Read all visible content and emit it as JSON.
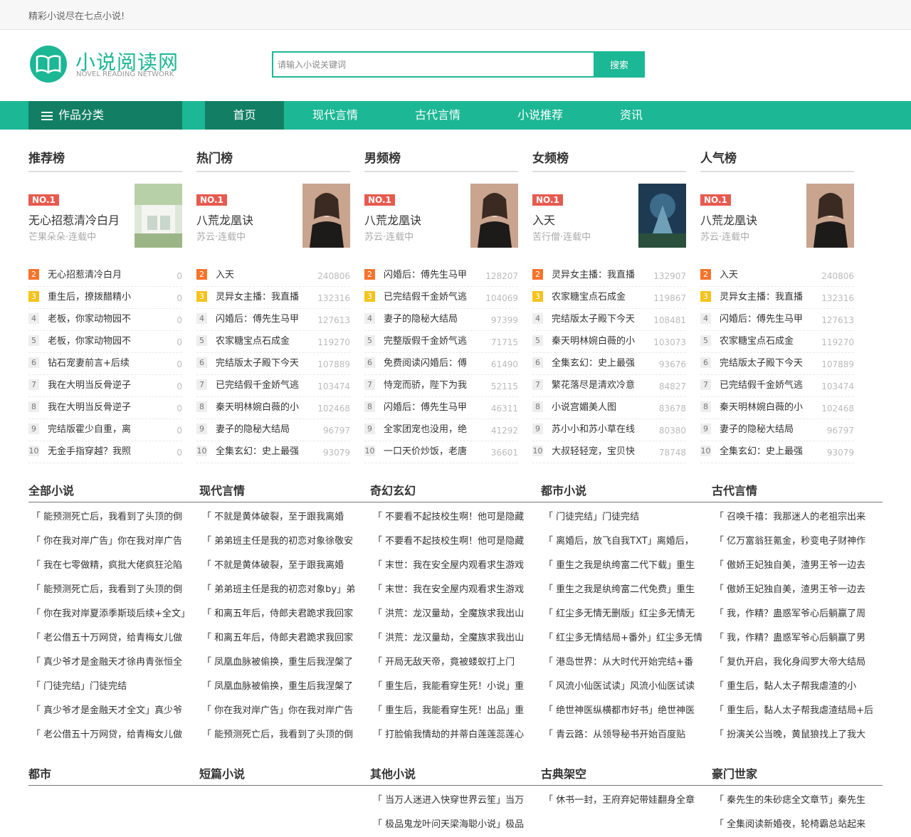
{
  "topbar": {
    "slogan": "精彩小说尽在七点小说!"
  },
  "logo": {
    "title": "小说阅读网",
    "subtitle": "NOVEL READING NETWORK",
    "icon": "open-book-icon"
  },
  "search": {
    "placeholder": "请输入小说关键词",
    "button": "搜索"
  },
  "nav": {
    "category": "作品分类",
    "items": [
      "首页",
      "现代言情",
      "古代言情",
      "小说推荐",
      "资讯"
    ]
  },
  "colors": {
    "accent": "#1cb795",
    "accent_dark": "#127f64",
    "badge": "#e85a4f"
  },
  "rankings": [
    {
      "title": "推荐榜",
      "badge": "NO.1",
      "featured_title": "无心招惹清冷白月",
      "featured_meta": "芒果朵朵·连载中",
      "items": [
        {
          "t": "无心招惹清冷白月",
          "c": "0"
        },
        {
          "t": "重生后，撩拨醋精小",
          "c": "0"
        },
        {
          "t": "老板，你家动物园不",
          "c": "0"
        },
        {
          "t": "老板，你家动物园不",
          "c": "0"
        },
        {
          "t": "钻石宠妻前言+后续",
          "c": "0"
        },
        {
          "t": "我在大明当反骨逆子",
          "c": "0"
        },
        {
          "t": "我在大明当反骨逆子",
          "c": "0"
        },
        {
          "t": "完结版霍少自重，离",
          "c": "0"
        },
        {
          "t": "无金手指穿越？我照",
          "c": "0"
        }
      ]
    },
    {
      "title": "热门榜",
      "badge": "NO.1",
      "featured_title": "八荒龙凰诀",
      "featured_meta": "苏云·连载中",
      "items": [
        {
          "t": "入天",
          "c": "240806"
        },
        {
          "t": "灵异女主播：我直播",
          "c": "132316"
        },
        {
          "t": "闪婚后：傅先生马甲",
          "c": "127613"
        },
        {
          "t": "农家糖宝点石成金",
          "c": "119270"
        },
        {
          "t": "完结版太子殿下今天",
          "c": "107889"
        },
        {
          "t": "已完结假千金娇气逃",
          "c": "103474"
        },
        {
          "t": "秦天明林婉白薇的小",
          "c": "102468"
        },
        {
          "t": "妻子的隐秘大结局",
          "c": "96797"
        },
        {
          "t": "全集玄幻：史上最强",
          "c": "93079"
        }
      ]
    },
    {
      "title": "男频榜",
      "badge": "NO.1",
      "featured_title": "八荒龙凰诀",
      "featured_meta": "苏云·连载中",
      "items": [
        {
          "t": "闪婚后：傅先生马甲",
          "c": "128207"
        },
        {
          "t": "已完结假千金娇气逃",
          "c": "104069"
        },
        {
          "t": "妻子的隐秘大结局",
          "c": "97399"
        },
        {
          "t": "完整版假千金娇气逃",
          "c": "71715"
        },
        {
          "t": "免费阅读闪婚后：傅",
          "c": "61490"
        },
        {
          "t": "恃宠而骄，陛下为我",
          "c": "52115"
        },
        {
          "t": "闪婚后：傅先生马甲",
          "c": "46311"
        },
        {
          "t": "全家团宠也没用，绝",
          "c": "41292"
        },
        {
          "t": "一口天价炒饭，老唐",
          "c": "36601"
        }
      ]
    },
    {
      "title": "女频榜",
      "badge": "NO.1",
      "featured_title": "入天",
      "featured_meta": "苦行僧·连载中",
      "items": [
        {
          "t": "灵异女主播：我直播",
          "c": "132907"
        },
        {
          "t": "农家糖宝点石成金",
          "c": "119867"
        },
        {
          "t": "完结版太子殿下今天",
          "c": "108481"
        },
        {
          "t": "秦天明林婉白薇的小",
          "c": "103073"
        },
        {
          "t": "全集玄幻：史上最强",
          "c": "93676"
        },
        {
          "t": "繁花落尽是清欢冷意",
          "c": "84827"
        },
        {
          "t": "小说宫媚美人图",
          "c": "83678"
        },
        {
          "t": "苏小小和苏小草在线",
          "c": "80380"
        },
        {
          "t": "大叔轻轻宠，宝贝快",
          "c": "78748"
        }
      ]
    },
    {
      "title": "人气榜",
      "badge": "NO.1",
      "featured_title": "八荒龙凰诀",
      "featured_meta": "苏云·连载中",
      "items": [
        {
          "t": "入天",
          "c": "240806"
        },
        {
          "t": "灵异女主播：我直播",
          "c": "132316"
        },
        {
          "t": "闪婚后：傅先生马甲",
          "c": "127613"
        },
        {
          "t": "农家糖宝点石成金",
          "c": "119270"
        },
        {
          "t": "完结版太子殿下今天",
          "c": "107889"
        },
        {
          "t": "已完结假千金娇气逃",
          "c": "103474"
        },
        {
          "t": "秦天明林婉白薇的小",
          "c": "102468"
        },
        {
          "t": "妻子的隐秘大结局",
          "c": "96797"
        },
        {
          "t": "全集玄幻：史上最强",
          "c": "93079"
        }
      ]
    }
  ],
  "section1": {
    "headers": [
      "全部小说",
      "现代言情",
      "奇幻玄幻",
      "都市小说",
      "古代言情"
    ],
    "cols": [
      [
        "「 能预测死亡后，我看到了头顶的倒",
        "「 你在我对岸广告」你在我对岸广告",
        "「 我在七零做精，疯批大佬疯狂沦陷",
        "「 能预测死亡后，我看到了头顶的倒",
        "「 你在我对岸夏添季斯琰后续+全文」",
        "「 老公借五十万网贷，给青梅女儿做",
        "「 真少爷才是金融天才徐冉青张恒全",
        "「 门徒完结」门徒完结",
        "「 真少爷才是金融天才全文」真少爷",
        "「 老公借五十万网贷，给青梅女儿做"
      ],
      [
        "「 不就是黄体破裂，至于跟我离婚",
        "「 弟弟班主任是我的初恋对象徐敬安",
        "「 不就是黄体破裂，至于跟我离婚",
        "「 弟弟班主任是我的初恋对象by」弟",
        "「 和离五年后，侍郎夫君跪求我回家",
        "「 和离五年后，侍郎夫君跪求我回家",
        "「 凤凰血脉被偷换，重生后我涅槃了",
        "「 凤凰血脉被偷换，重生后我涅槃了",
        "「 你在我对岸广告」你在我对岸广告",
        "「 能预测死亡后，我看到了头顶的倒"
      ],
      [
        "「 不要看不起技校生啊！他可是隐藏",
        "「 不要看不起技校生啊！他可是隐藏",
        "「 末世：我在安全屋内观看求生游戏",
        "「 末世：我在安全屋内观看求生游戏",
        "「 洪荒：龙汉量劫，全魔族求我出山",
        "「 洪荒：龙汉量劫，全魔族求我出山",
        "「 开局无敌天帝，竟被蝼蚁打上门",
        "「 重生后，我能看穿生死！小说」重",
        "「 重生后，我能看穿生死！出品」重",
        "「 打脸偷我情劫的并蒂白莲莲蕊莲心"
      ],
      [
        "「 门徒完结」门徒完结",
        "「 离婚后，放飞自我TXT」离婚后，",
        "「 重生之我是纨绔富二代下载」重生",
        "「 重生之我是纨绔富二代免费」重生",
        "「 红尘多无情无删版」红尘多无情无",
        "「 红尘多无情结局+番外」红尘多无情",
        "「 港岛世界：从大时代开始完结+番",
        "「 风流小仙医试读」风流小仙医试读",
        "「 绝世神医纵横都市好书」绝世神医",
        "「 青云路：从领导秘书开始百度贴"
      ],
      [
        "「 召唤千禧：我那迷人的老祖宗出来",
        "「 亿万富翁狂氪金，秒变电子财神作",
        "「 傲娇王妃独自美，渣男王爷一边去",
        "「 傲娇王妃独自美，渣男王爷一边去",
        "「 我，作精？蛊惑军爷心后躺赢了周",
        "「 我，作精？蛊惑军爷心后躺赢了男",
        "「 复仇开启，我化身阎罗大帝大结局",
        "「 重生后，黏人太子帮我虐渣的小",
        "「 重生后，黏人太子帮我虐渣结局+后",
        "「 扮演关公当晚，黄鼠狼找上了我大"
      ]
    ]
  },
  "section2": {
    "headers": [
      "都市",
      "短篇小说",
      "其他小说",
      "古典架空",
      "豪门世家"
    ],
    "cols": [
      [],
      [],
      [
        "「 当万人迷进入快穿世界云笙」当万",
        "「 极品鬼龙叶问天梁海聪小说」极品"
      ],
      [
        "「 休书一封，王府弃妃带娃翻身全章"
      ],
      [
        "「 秦先生的朱砂痣全文章节」秦先生",
        "「 全集阅读新婚夜，轮椅霸总站起来"
      ]
    ]
  }
}
